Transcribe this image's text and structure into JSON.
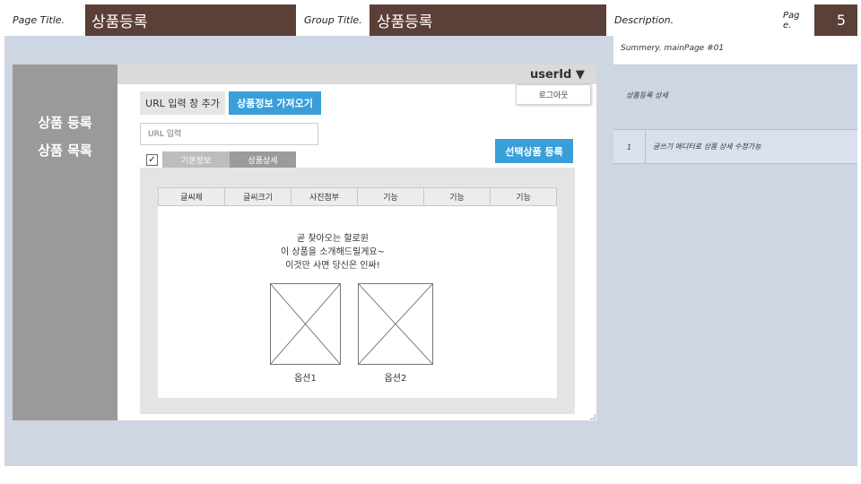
{
  "header": {
    "page_title_label": "Page Title.",
    "page_title_value": "상품등록",
    "group_title_label": "Group Title.",
    "group_title_value": "상품등록",
    "description_label": "Description.",
    "page_label": "Pag\ne.",
    "page_number": "5"
  },
  "sidebar": {
    "items": [
      {
        "label": "상품 등록"
      },
      {
        "label": "상품 목록"
      }
    ]
  },
  "topbar": {
    "user_label": "userId ▼",
    "logout_label": "로그아웃"
  },
  "form": {
    "url_add_button": "URL 입력 창 추가",
    "fetch_button": "상품정보 가져오기",
    "url_input_placeholder": "URL 입력",
    "register_selected_button": "선택상품 등록",
    "checkbox_mark": "✓",
    "tabs": [
      "기본정보",
      "상품상세"
    ]
  },
  "editor": {
    "toolbar": [
      "글씨체",
      "글씨크기",
      "사진첨부",
      "기능",
      "기능",
      "기능"
    ],
    "content_lines": [
      "곧 찾아오는 할로윈",
      "이 상품을 소개해드릴게요~",
      "이것만 사면 당신은 인싸!"
    ],
    "options": [
      "옵션1",
      "옵션2"
    ]
  },
  "description": {
    "summary": "Summery. mainPage #01",
    "section_title": "상품등록 상세",
    "rows": [
      {
        "num": "1",
        "text": "글쓰기 에디터로 상품 상세 수정가능"
      }
    ]
  },
  "colors": {
    "header_brown": "#5b4037",
    "canvas_blue_gray": "#ced5e3",
    "sidebar_gray": "#9a9a9a",
    "button_blue": "#3a9fd8"
  }
}
